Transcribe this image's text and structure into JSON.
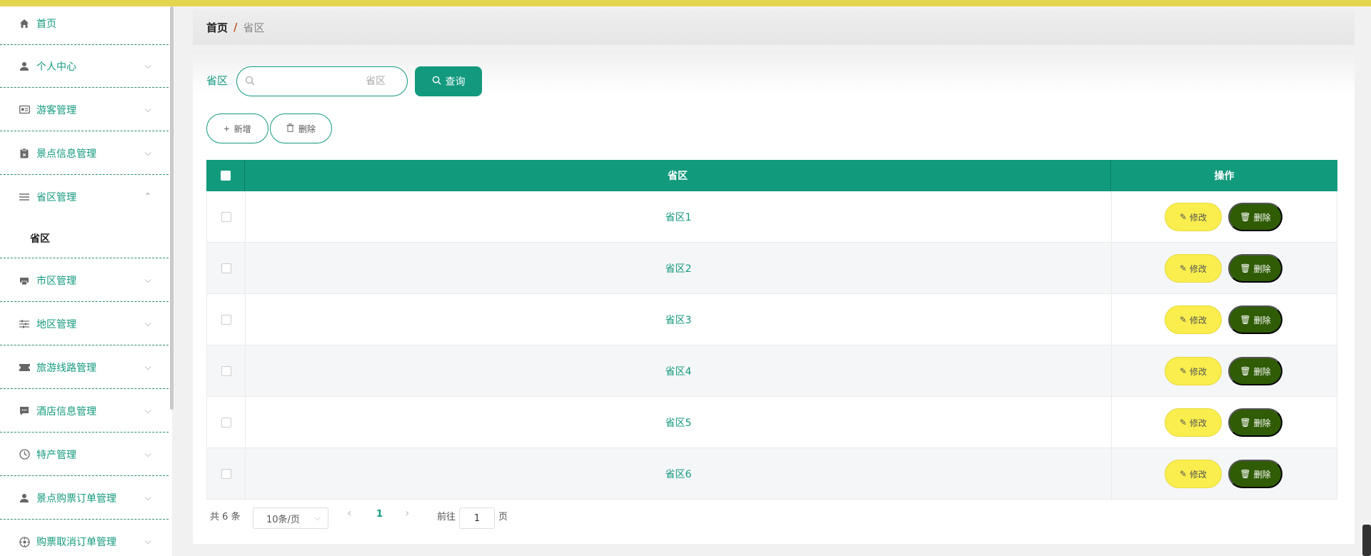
{
  "sidebar": {
    "items": [
      {
        "label": "首页",
        "icon": "home-icon"
      },
      {
        "label": "个人中心",
        "icon": "user-icon"
      },
      {
        "label": "游客管理",
        "icon": "id-card-icon"
      },
      {
        "label": "景点信息管理",
        "icon": "clipboard-icon"
      },
      {
        "label": "省区管理",
        "icon": "list-icon",
        "expanded": true
      },
      {
        "label": "市区管理",
        "icon": "printer-icon"
      },
      {
        "label": "地区管理",
        "icon": "sliders-icon"
      },
      {
        "label": "旅游线路管理",
        "icon": "ticket-icon"
      },
      {
        "label": "酒店信息管理",
        "icon": "chat-icon"
      },
      {
        "label": "特产管理",
        "icon": "clock-icon"
      },
      {
        "label": "景点购票订单管理",
        "icon": "user-icon"
      },
      {
        "label": "购票取消订单管理",
        "icon": "compass-icon"
      }
    ],
    "submenu": {
      "label": "省区"
    }
  },
  "breadcrumb": {
    "home": "首页",
    "separator": "/",
    "current": "省区"
  },
  "search": {
    "label": "省区",
    "placeholder": "省区",
    "button": "查询"
  },
  "actions": {
    "add": "新增",
    "delete": "删除"
  },
  "table": {
    "headers": {
      "province": "省区",
      "operation": "操作"
    },
    "rows": [
      {
        "province": "省区1"
      },
      {
        "province": "省区2"
      },
      {
        "province": "省区3"
      },
      {
        "province": "省区4"
      },
      {
        "province": "省区5"
      },
      {
        "province": "省区6"
      }
    ],
    "edit_label": "修改",
    "delete_label": "删除"
  },
  "pagination": {
    "total": "共 6 条",
    "page_size": "10条/页",
    "current_page": "1",
    "prev": "‹",
    "next": "›",
    "goto_label": "前往",
    "goto_value": "1",
    "page_suffix": "页"
  },
  "colors": {
    "accent": "#139a7e",
    "top_bar": "#e3d54e",
    "edit_button": "#f9ee4d",
    "delete_button": "#2f5c05"
  }
}
